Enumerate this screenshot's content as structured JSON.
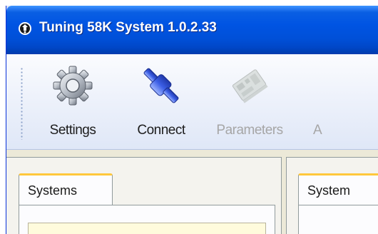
{
  "window": {
    "title": "Tuning 58K System 1.0.2.33",
    "accent_color": "#0054e3",
    "icon": "app-logo-icon"
  },
  "toolbar": {
    "items": [
      {
        "label": "Settings",
        "icon": "gear-icon",
        "enabled": true
      },
      {
        "label": "Connect",
        "icon": "connector-icon",
        "enabled": true
      },
      {
        "label": "Parameters",
        "icon": "circuit-board-icon",
        "enabled": false
      },
      {
        "label": "A",
        "icon": "",
        "enabled": false
      }
    ]
  },
  "panels": {
    "left": {
      "tab_label": "Systems"
    },
    "right": {
      "tab_label": "System"
    }
  }
}
